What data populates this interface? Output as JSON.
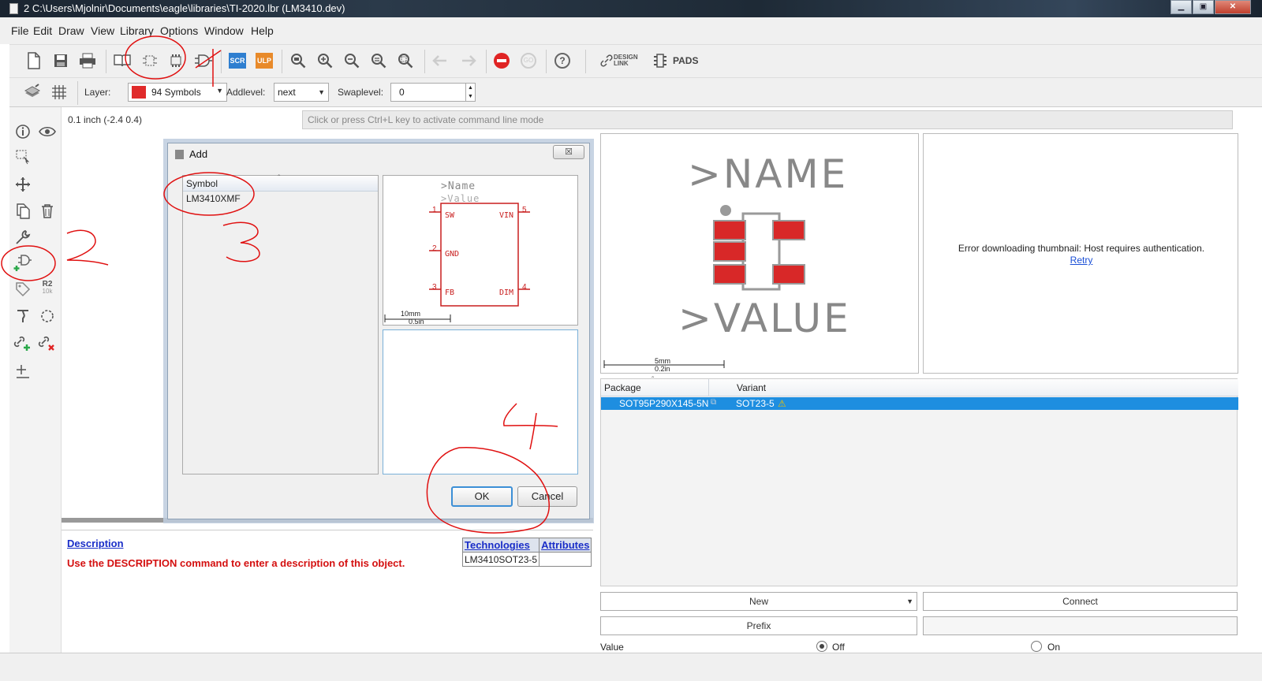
{
  "window": {
    "title": "2 C:\\Users\\Mjolnir\\Documents\\eagle\\libraries\\TI-2020.lbr (LM3410.dev)",
    "minimize": "▁",
    "maximize": "▣",
    "close": "✕"
  },
  "menu": [
    "File",
    "Edit",
    "Draw",
    "View",
    "Library",
    "Options",
    "Window",
    "Help"
  ],
  "toolbar": {
    "scr": "SCR",
    "ulp": "ULP",
    "stop_secondary": "GO",
    "help": "?",
    "design_link": "DESIGN LINK",
    "pads": "PADS"
  },
  "params": {
    "layer_label": "Layer:",
    "layer_value": "94 Symbols",
    "layer_color": "#e02a2a",
    "addlevel_label": "Addlevel:",
    "addlevel_value": "next",
    "swaplevel_label": "Swaplevel:",
    "swaplevel_value": "0"
  },
  "coords": "0.1 inch (-2.4 0.4)",
  "command_placeholder": "Click or press Ctrl+L key to activate command line mode",
  "palette": {
    "r2": "R2",
    "r2_sub": "10k"
  },
  "dialog": {
    "title": "Add",
    "close": "☒",
    "list_header": "Symbol",
    "symbols": [
      "LM3410XMF"
    ],
    "preview": {
      "name": ">Name",
      "value": ">Value",
      "pins": [
        {
          "num": "1",
          "name": "SW"
        },
        {
          "num": "2",
          "name": "GND"
        },
        {
          "num": "3",
          "name": "FB"
        },
        {
          "num": "5",
          "name": "VIN"
        },
        {
          "num": "4",
          "name": "DIM"
        }
      ],
      "scale_top": "10mm",
      "scale_bottom": "0.5in"
    },
    "ok": "OK",
    "cancel": "Cancel"
  },
  "package_preview": {
    "name": ">NAME",
    "value": ">VALUE",
    "scale_top": "5mm",
    "scale_bottom": "0.2in"
  },
  "thumbnail": {
    "message": "Error downloading thumbnail: Host requires authentication.",
    "retry": "Retry"
  },
  "packages": {
    "headers": [
      "Package",
      "Variant"
    ],
    "rows": [
      {
        "package": "SOT95P290X145-5N",
        "variant": "SOT23-5"
      }
    ]
  },
  "device_buttons": {
    "new": "New",
    "connect": "Connect",
    "prefix": "Prefix"
  },
  "value_option": {
    "label": "Value",
    "off": "Off",
    "on": "On"
  },
  "description": {
    "link": "Description",
    "message": "Use the DESCRIPTION command to enter a description of this object."
  },
  "tech_table": {
    "technologies": "Technologies",
    "attributes": "Attributes",
    "rows": [
      "LM3410SOT23-5"
    ]
  },
  "annotations": [
    "1",
    "2",
    "3",
    "4"
  ]
}
